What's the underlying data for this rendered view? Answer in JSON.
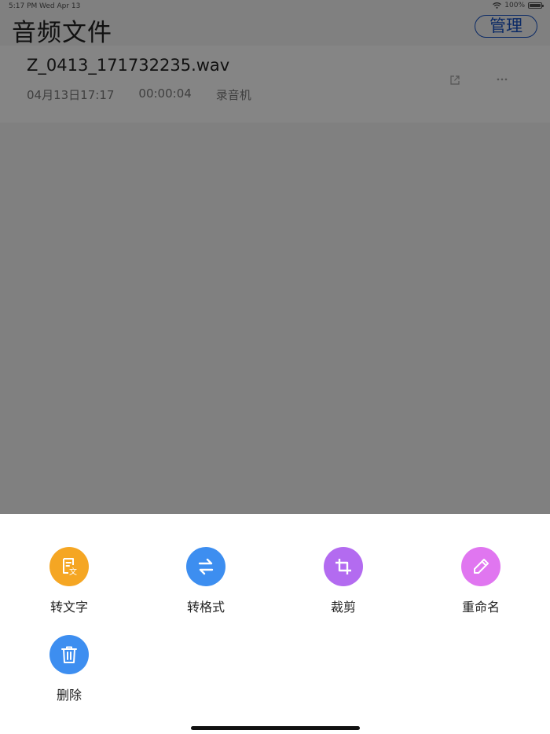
{
  "status": {
    "time": "5:17 PM",
    "date": "Wed Apr 13",
    "battery": "100%",
    "battery_level": 1.0
  },
  "header": {
    "title": "音频文件",
    "manage_label": "管理"
  },
  "file": {
    "name": "Z_0413_171732235.wav",
    "date": "04月13日17:17",
    "duration": "00:00:04",
    "source": "录音机"
  },
  "actions": [
    {
      "label": "转文字",
      "icon": "transcribe-icon",
      "color": "#F5A623"
    },
    {
      "label": "转格式",
      "icon": "convert-format-icon",
      "color": "#3D8EF0"
    },
    {
      "label": "裁剪",
      "icon": "crop-icon",
      "color": "#B36BF0"
    },
    {
      "label": "重命名",
      "icon": "rename-pencil-icon",
      "color": "#E076F0"
    },
    {
      "label": "删除",
      "icon": "trash-icon",
      "color": "#3D8EF0"
    }
  ],
  "colors": {
    "overlay": "#808080",
    "manage_border": "#0b2a66"
  }
}
